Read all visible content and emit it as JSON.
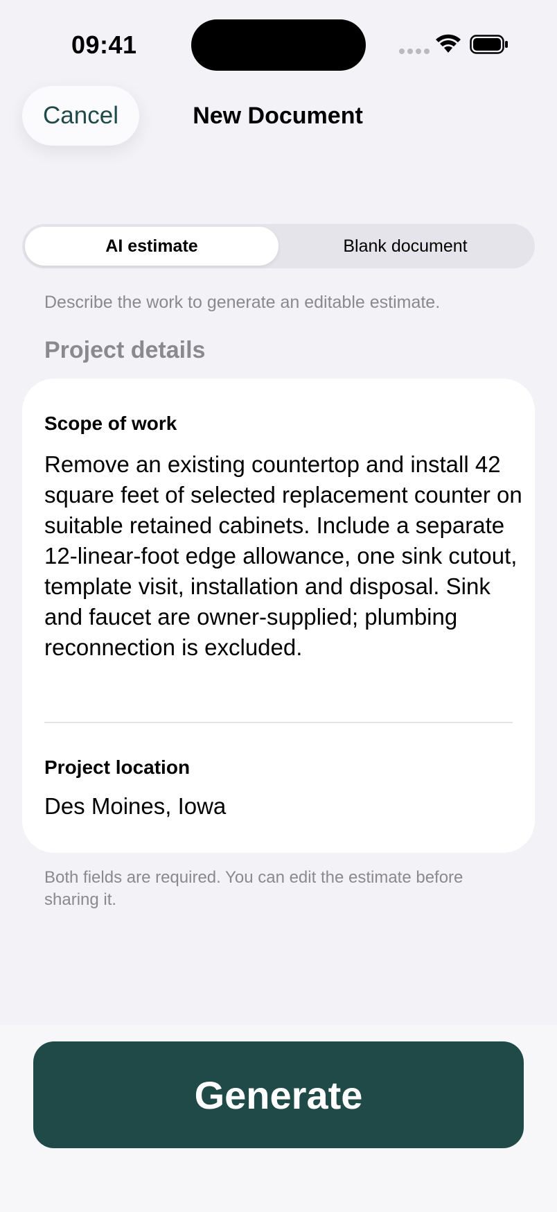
{
  "status_bar": {
    "time": "09:41"
  },
  "nav": {
    "cancel_label": "Cancel",
    "title": "New Document"
  },
  "mode_selector": {
    "options": [
      {
        "label": "AI estimate",
        "selected": true
      },
      {
        "label": "Blank document",
        "selected": false
      }
    ]
  },
  "helper_text": "Describe the work to generate an editable estimate.",
  "section_title": "Project details",
  "form": {
    "scope": {
      "label": "Scope of work",
      "value": "Remove an existing countertop and install 42 square feet of selected replacement counter on suitable retained cabinets. Include a separate 12-linear-foot edge allowance, one sink cutout, template visit, installation and disposal. Sink and faucet are owner-supplied; plumbing reconnection is excluded."
    },
    "location": {
      "label": "Project location",
      "value": "Des Moines, Iowa"
    }
  },
  "footnote": "Both fields are required. You can edit the estimate before sharing it.",
  "generate_label": "Generate",
  "colors": {
    "accent": "#1f4a48",
    "background": "#f2f2f7",
    "secondary_text": "#8a8a8e"
  },
  "icons": [
    "signal-icon",
    "wifi-icon",
    "battery-icon"
  ]
}
